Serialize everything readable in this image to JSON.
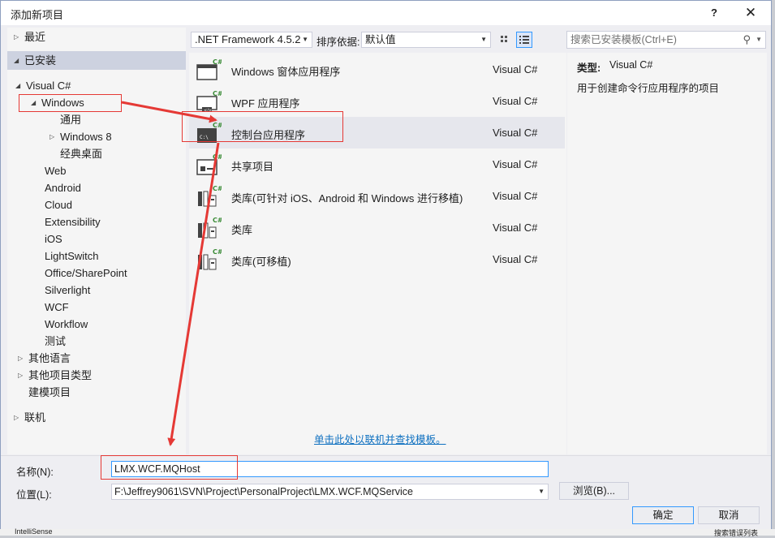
{
  "window": {
    "title": "添加新项目",
    "help_glyph": "?",
    "close_glyph": "✕"
  },
  "left_tree": {
    "recent": "最近",
    "installed": "已安装",
    "visual_csharp": "Visual C#",
    "windows": "Windows",
    "general": "通用",
    "windows8": "Windows 8",
    "classic_desktop": "经典桌面",
    "items": [
      "Web",
      "Android",
      "Cloud",
      "Extensibility",
      "iOS",
      "LightSwitch",
      "Office/SharePoint",
      "Silverlight",
      "WCF",
      "Workflow",
      "测试"
    ],
    "other_languages": "其他语言",
    "other_project_types": "其他项目类型",
    "modeling": "建模项目",
    "online": "联机"
  },
  "toolbar": {
    "framework": ".NET Framework 4.5.2",
    "sort_label": "排序依据:",
    "sort_value": "默认值"
  },
  "search": {
    "placeholder": "搜索已安装模板(Ctrl+E)"
  },
  "templates": [
    {
      "name": "Windows 窗体应用程序",
      "lang": "Visual C#",
      "icon": "winforms-icon",
      "selected": false
    },
    {
      "name": "WPF 应用程序",
      "lang": "Visual C#",
      "icon": "wpf-icon",
      "selected": false
    },
    {
      "name": "控制台应用程序",
      "lang": "Visual C#",
      "icon": "console-icon",
      "selected": true
    },
    {
      "name": "共享项目",
      "lang": "Visual C#",
      "icon": "shared-project-icon",
      "selected": false
    },
    {
      "name": "类库(可针对 iOS、Android 和 Windows 进行移植)",
      "lang": "Visual C#",
      "icon": "portable-library-icon",
      "selected": false
    },
    {
      "name": "类库",
      "lang": "Visual C#",
      "icon": "class-library-icon",
      "selected": false
    },
    {
      "name": "类库(可移植)",
      "lang": "Visual C#",
      "icon": "portable-class-library-icon",
      "selected": false
    }
  ],
  "online_link": "单击此处以联机并查找模板。",
  "details": {
    "type_label": "类型:",
    "type_value": "Visual C#",
    "description": "用于创建命令行应用程序的项目"
  },
  "form": {
    "name_label": "名称(N):",
    "name_value": "LMX.WCF.MQHost",
    "location_label": "位置(L):",
    "location_value": "F:\\Jeffrey9061\\SVN\\Project\\PersonalProject\\LMX.WCF.MQService",
    "browse": "浏览(B)...",
    "ok": "确定",
    "cancel": "取消"
  },
  "background": {
    "left_text": "IntelliSense",
    "right_text": "搜索错误列表"
  },
  "colors": {
    "annotation_red": "#e53935",
    "link_blue": "#0e70c0",
    "selection": "#cdd2e0"
  }
}
